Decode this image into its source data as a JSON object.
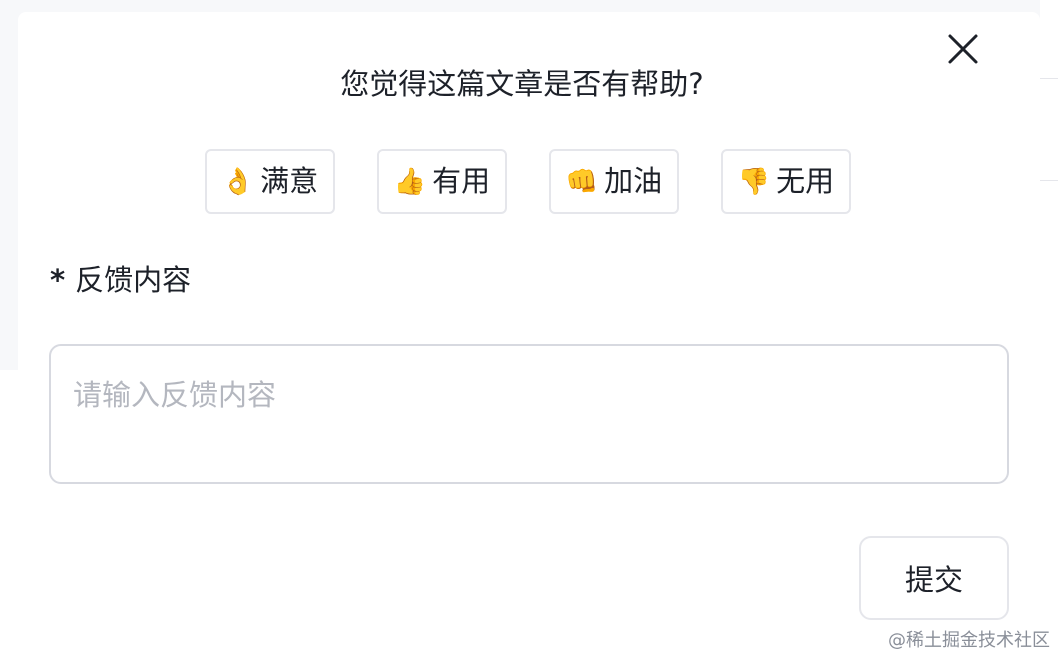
{
  "dialog": {
    "title": "您觉得这篇文章是否有帮助?",
    "close_icon": "close-icon"
  },
  "reactions": [
    {
      "emoji": "👌",
      "label": "满意"
    },
    {
      "emoji": "👍",
      "label": "有用"
    },
    {
      "emoji": "👊",
      "label": "加油"
    },
    {
      "emoji": "👎",
      "label": "无用"
    }
  ],
  "feedback": {
    "required_mark": "*",
    "label": "反馈内容",
    "placeholder": "请输入反馈内容",
    "value": ""
  },
  "submit": {
    "label": "提交"
  },
  "watermark": "@稀土掘金技术社区",
  "colors": {
    "text": "#1d2129",
    "border": "#e5e6eb",
    "placeholder": "#b4b7bf"
  }
}
